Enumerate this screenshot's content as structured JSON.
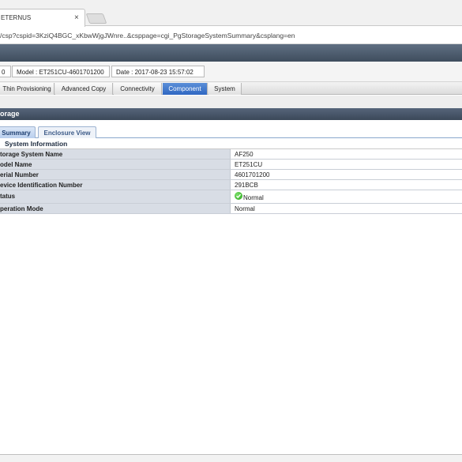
{
  "browser": {
    "tab_title": "ETERNUS",
    "tab_close": "×",
    "url": "/csp?cspid=3KziQ4BGC_xKbwWjgJWnre..&csppage=cgi_PgStorageSystemSummary&csplang=en"
  },
  "status": {
    "model_prefix": "0",
    "model": "Model : ET251CU-4601701200",
    "date": "Date : 2017-08-23 15:57:02"
  },
  "nav": {
    "tabs": [
      {
        "label": "Thin Provisioning",
        "active": false
      },
      {
        "label": "Advanced Copy",
        "active": false
      },
      {
        "label": "Connectivity",
        "active": false
      },
      {
        "label": "Component",
        "active": true
      },
      {
        "label": "System",
        "active": false
      }
    ]
  },
  "section": {
    "title": "orage"
  },
  "subtabs": [
    {
      "label": "Summary",
      "active": true
    },
    {
      "label": "Enclosure View",
      "active": false
    }
  ],
  "info": {
    "header": "System Information",
    "rows": [
      {
        "label": "torage System Name",
        "value": "AF250"
      },
      {
        "label": "odel Name",
        "value": "ET251CU"
      },
      {
        "label": "erial Number",
        "value": "4601701200"
      },
      {
        "label": "evice Identification Number",
        "value": "291BCB"
      },
      {
        "label": "tatus",
        "value": "Normal",
        "icon": "check-circle-icon"
      },
      {
        "label": "peration Mode",
        "value": "Normal"
      }
    ]
  },
  "colors": {
    "accent": "#2f67c2",
    "header_dark": "#3f4d5e",
    "status_ok": "#24a316"
  }
}
